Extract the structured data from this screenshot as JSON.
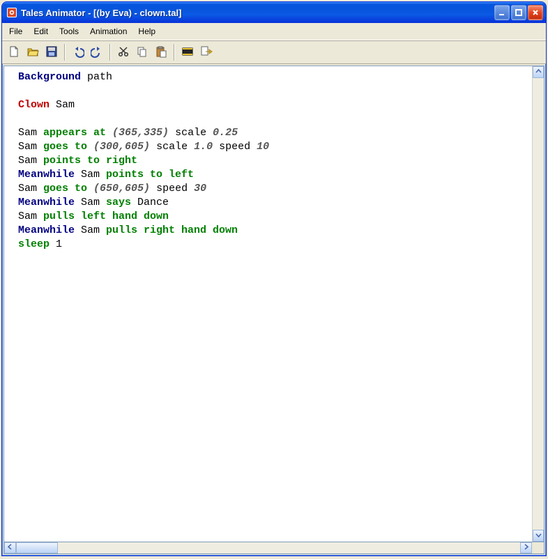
{
  "window": {
    "title": "Tales Animator - [(by Eva) - clown.tal]"
  },
  "menubar": {
    "items": [
      "File",
      "Edit",
      "Tools",
      "Animation",
      "Help"
    ]
  },
  "toolbar": {
    "groups": [
      [
        "new",
        "open",
        "save"
      ],
      [
        "undo",
        "redo"
      ],
      [
        "cut",
        "copy",
        "paste"
      ],
      [
        "animate",
        "export"
      ]
    ],
    "names": {
      "new": "New",
      "open": "Open",
      "save": "Save",
      "undo": "Undo",
      "redo": "Redo",
      "cut": "Cut",
      "copy": "Copy",
      "paste": "Paste",
      "animate": "Animate",
      "export": "Export"
    }
  },
  "code": {
    "lines": [
      [
        {
          "cls": "kw-navy",
          "t": "Background"
        },
        {
          "cls": "plain",
          "t": " path"
        }
      ],
      [],
      [
        {
          "cls": "kw-red",
          "t": "Clown"
        },
        {
          "cls": "plain",
          "t": " Sam"
        }
      ],
      [],
      [
        {
          "cls": "plain",
          "t": "Sam "
        },
        {
          "cls": "kw-green",
          "t": "appears at"
        },
        {
          "cls": "plain",
          "t": " "
        },
        {
          "cls": "kw-gray",
          "t": "(365,335)"
        },
        {
          "cls": "plain",
          "t": " scale "
        },
        {
          "cls": "kw-gray",
          "t": "0.25"
        }
      ],
      [
        {
          "cls": "plain",
          "t": "Sam "
        },
        {
          "cls": "kw-green",
          "t": "goes to"
        },
        {
          "cls": "plain",
          "t": " "
        },
        {
          "cls": "kw-gray",
          "t": "(300,605)"
        },
        {
          "cls": "plain",
          "t": " scale "
        },
        {
          "cls": "kw-gray",
          "t": "1.0"
        },
        {
          "cls": "plain",
          "t": " speed "
        },
        {
          "cls": "kw-gray",
          "t": "10"
        }
      ],
      [
        {
          "cls": "plain",
          "t": "Sam "
        },
        {
          "cls": "kw-green",
          "t": "points to right"
        }
      ],
      [
        {
          "cls": "kw-navy",
          "t": "Meanwhile"
        },
        {
          "cls": "plain",
          "t": " Sam "
        },
        {
          "cls": "kw-green",
          "t": "points to left"
        }
      ],
      [
        {
          "cls": "plain",
          "t": "Sam "
        },
        {
          "cls": "kw-green",
          "t": "goes to"
        },
        {
          "cls": "plain",
          "t": " "
        },
        {
          "cls": "kw-gray",
          "t": "(650,605)"
        },
        {
          "cls": "plain",
          "t": " speed "
        },
        {
          "cls": "kw-gray",
          "t": "30"
        }
      ],
      [
        {
          "cls": "kw-navy",
          "t": "Meanwhile"
        },
        {
          "cls": "plain",
          "t": " Sam "
        },
        {
          "cls": "kw-green",
          "t": "says"
        },
        {
          "cls": "plain",
          "t": " Dance"
        }
      ],
      [
        {
          "cls": "plain",
          "t": "Sam "
        },
        {
          "cls": "kw-green",
          "t": "pulls left hand down"
        }
      ],
      [
        {
          "cls": "kw-navy",
          "t": "Meanwhile"
        },
        {
          "cls": "plain",
          "t": " Sam "
        },
        {
          "cls": "kw-green",
          "t": "pulls right hand down"
        }
      ],
      [
        {
          "cls": "kw-green",
          "t": "sleep"
        },
        {
          "cls": "plain",
          "t": " 1"
        }
      ]
    ]
  },
  "colors": {
    "keyword_navy": "#000080",
    "keyword_red": "#c00000",
    "keyword_green": "#008000",
    "literal_gray": "#555555",
    "titlebar_blue": "#0855dd",
    "close_red": "#e3431e",
    "chrome_bg": "#ece9d8"
  }
}
